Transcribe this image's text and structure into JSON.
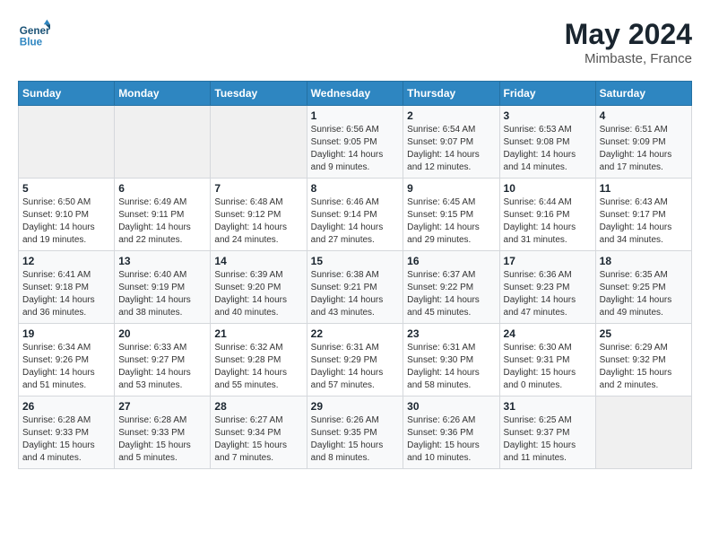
{
  "header": {
    "logo_line1": "General",
    "logo_line2": "Blue",
    "month": "May 2024",
    "location": "Mimbaste, France"
  },
  "weekdays": [
    "Sunday",
    "Monday",
    "Tuesday",
    "Wednesday",
    "Thursday",
    "Friday",
    "Saturday"
  ],
  "weeks": [
    [
      {
        "day": "",
        "info": ""
      },
      {
        "day": "",
        "info": ""
      },
      {
        "day": "",
        "info": ""
      },
      {
        "day": "1",
        "info": "Sunrise: 6:56 AM\nSunset: 9:05 PM\nDaylight: 14 hours\nand 9 minutes."
      },
      {
        "day": "2",
        "info": "Sunrise: 6:54 AM\nSunset: 9:07 PM\nDaylight: 14 hours\nand 12 minutes."
      },
      {
        "day": "3",
        "info": "Sunrise: 6:53 AM\nSunset: 9:08 PM\nDaylight: 14 hours\nand 14 minutes."
      },
      {
        "day": "4",
        "info": "Sunrise: 6:51 AM\nSunset: 9:09 PM\nDaylight: 14 hours\nand 17 minutes."
      }
    ],
    [
      {
        "day": "5",
        "info": "Sunrise: 6:50 AM\nSunset: 9:10 PM\nDaylight: 14 hours\nand 19 minutes."
      },
      {
        "day": "6",
        "info": "Sunrise: 6:49 AM\nSunset: 9:11 PM\nDaylight: 14 hours\nand 22 minutes."
      },
      {
        "day": "7",
        "info": "Sunrise: 6:48 AM\nSunset: 9:12 PM\nDaylight: 14 hours\nand 24 minutes."
      },
      {
        "day": "8",
        "info": "Sunrise: 6:46 AM\nSunset: 9:14 PM\nDaylight: 14 hours\nand 27 minutes."
      },
      {
        "day": "9",
        "info": "Sunrise: 6:45 AM\nSunset: 9:15 PM\nDaylight: 14 hours\nand 29 minutes."
      },
      {
        "day": "10",
        "info": "Sunrise: 6:44 AM\nSunset: 9:16 PM\nDaylight: 14 hours\nand 31 minutes."
      },
      {
        "day": "11",
        "info": "Sunrise: 6:43 AM\nSunset: 9:17 PM\nDaylight: 14 hours\nand 34 minutes."
      }
    ],
    [
      {
        "day": "12",
        "info": "Sunrise: 6:41 AM\nSunset: 9:18 PM\nDaylight: 14 hours\nand 36 minutes."
      },
      {
        "day": "13",
        "info": "Sunrise: 6:40 AM\nSunset: 9:19 PM\nDaylight: 14 hours\nand 38 minutes."
      },
      {
        "day": "14",
        "info": "Sunrise: 6:39 AM\nSunset: 9:20 PM\nDaylight: 14 hours\nand 40 minutes."
      },
      {
        "day": "15",
        "info": "Sunrise: 6:38 AM\nSunset: 9:21 PM\nDaylight: 14 hours\nand 43 minutes."
      },
      {
        "day": "16",
        "info": "Sunrise: 6:37 AM\nSunset: 9:22 PM\nDaylight: 14 hours\nand 45 minutes."
      },
      {
        "day": "17",
        "info": "Sunrise: 6:36 AM\nSunset: 9:23 PM\nDaylight: 14 hours\nand 47 minutes."
      },
      {
        "day": "18",
        "info": "Sunrise: 6:35 AM\nSunset: 9:25 PM\nDaylight: 14 hours\nand 49 minutes."
      }
    ],
    [
      {
        "day": "19",
        "info": "Sunrise: 6:34 AM\nSunset: 9:26 PM\nDaylight: 14 hours\nand 51 minutes."
      },
      {
        "day": "20",
        "info": "Sunrise: 6:33 AM\nSunset: 9:27 PM\nDaylight: 14 hours\nand 53 minutes."
      },
      {
        "day": "21",
        "info": "Sunrise: 6:32 AM\nSunset: 9:28 PM\nDaylight: 14 hours\nand 55 minutes."
      },
      {
        "day": "22",
        "info": "Sunrise: 6:31 AM\nSunset: 9:29 PM\nDaylight: 14 hours\nand 57 minutes."
      },
      {
        "day": "23",
        "info": "Sunrise: 6:31 AM\nSunset: 9:30 PM\nDaylight: 14 hours\nand 58 minutes."
      },
      {
        "day": "24",
        "info": "Sunrise: 6:30 AM\nSunset: 9:31 PM\nDaylight: 15 hours\nand 0 minutes."
      },
      {
        "day": "25",
        "info": "Sunrise: 6:29 AM\nSunset: 9:32 PM\nDaylight: 15 hours\nand 2 minutes."
      }
    ],
    [
      {
        "day": "26",
        "info": "Sunrise: 6:28 AM\nSunset: 9:33 PM\nDaylight: 15 hours\nand 4 minutes."
      },
      {
        "day": "27",
        "info": "Sunrise: 6:28 AM\nSunset: 9:33 PM\nDaylight: 15 hours\nand 5 minutes."
      },
      {
        "day": "28",
        "info": "Sunrise: 6:27 AM\nSunset: 9:34 PM\nDaylight: 15 hours\nand 7 minutes."
      },
      {
        "day": "29",
        "info": "Sunrise: 6:26 AM\nSunset: 9:35 PM\nDaylight: 15 hours\nand 8 minutes."
      },
      {
        "day": "30",
        "info": "Sunrise: 6:26 AM\nSunset: 9:36 PM\nDaylight: 15 hours\nand 10 minutes."
      },
      {
        "day": "31",
        "info": "Sunrise: 6:25 AM\nSunset: 9:37 PM\nDaylight: 15 hours\nand 11 minutes."
      },
      {
        "day": "",
        "info": ""
      }
    ]
  ]
}
